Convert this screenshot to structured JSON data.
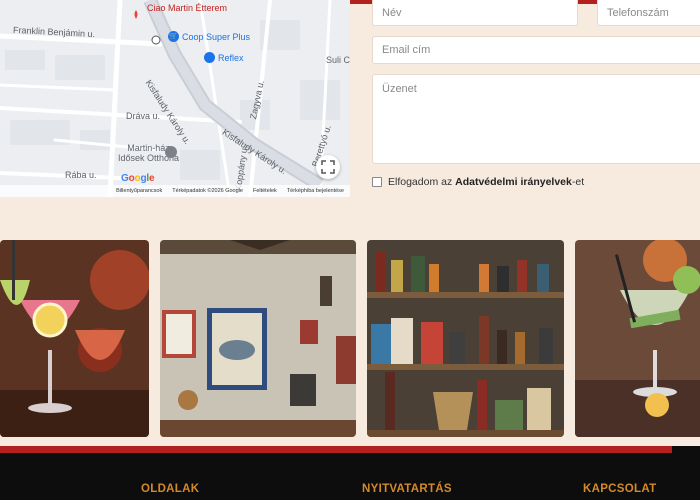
{
  "map": {
    "place_name": "Ciao Martin Étterem",
    "streets": {
      "franklin": "Franklin Benjámin u.",
      "kisfaludy_a": "Kisfaludy Károly u.",
      "kisfaludy_b": "Kisfaludy Károly u.",
      "drava": "Dráva u.",
      "raba": "Rába u.",
      "zagyva": "Zagyva u.",
      "koppany": "Koppány u.",
      "berettyo": "Berettyó u."
    },
    "pois": {
      "coop": "Coop Super Plus",
      "reflex": "Reflex",
      "suli": "Suli C",
      "martinhaz_line1": "Martin-ház",
      "martinhaz_line2": "Idősek Otthona"
    },
    "google": [
      "G",
      "o",
      "o",
      "g",
      "l",
      "e"
    ],
    "google_colors": [
      "#4285f4",
      "#ea4335",
      "#fbbc05",
      "#4285f4",
      "#34a853",
      "#ea4335"
    ],
    "footer": {
      "shortcuts": "Billentyűparancsok",
      "mapdata": "Térképadatok ©2026 Google",
      "terms": "Feltételek",
      "report": "Térképhiba bejelentése"
    }
  },
  "form": {
    "name_placeholder": "Név",
    "phone_placeholder": "Telefonszám",
    "email_placeholder": "Email cím",
    "message_placeholder": "Üzenet",
    "consent_prefix": "Elfogadom az ",
    "consent_link": "Adatvédelmi irányelvek",
    "consent_suffix": "-et"
  },
  "footer": {
    "col1": "OLDALAK",
    "col2": "NYITVATARTÁS",
    "col3": "KAPCSOLAT"
  },
  "colors": {
    "accent_red": "#b3211e",
    "footer_heading": "#d48a2a",
    "background": "#f7ebe0"
  }
}
